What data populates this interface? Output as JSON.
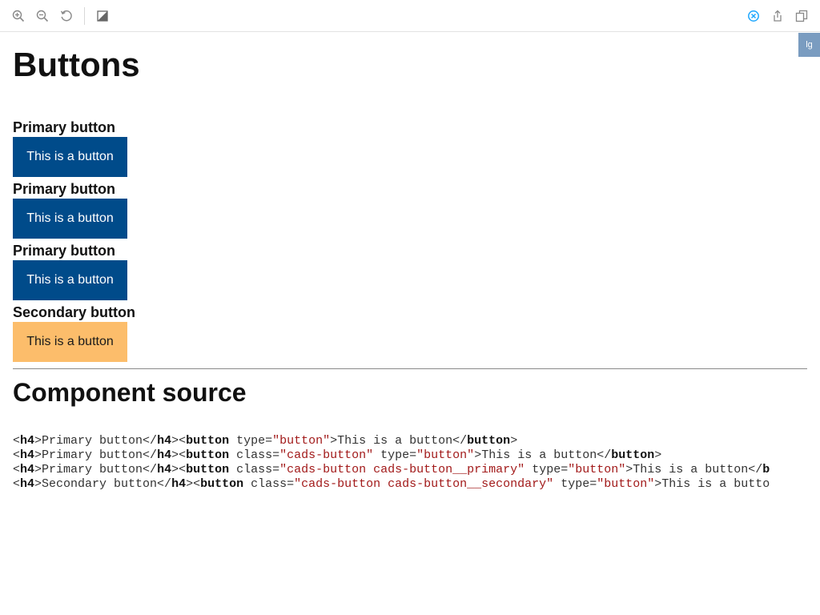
{
  "toolbar": {
    "icons": [
      "zoom-in-icon",
      "zoom-out-icon",
      "reset-zoom-icon",
      "background-icon",
      "close-icon",
      "share-icon",
      "copy-icon"
    ],
    "accent_color": "#1ea7fd"
  },
  "viewport_badge": "lg",
  "page": {
    "title": "Buttons",
    "groups": [
      {
        "heading": "Primary button",
        "button_label": "This is a button",
        "variant": "primary"
      },
      {
        "heading": "Primary button",
        "button_label": "This is a button",
        "variant": "primary"
      },
      {
        "heading": "Primary button",
        "button_label": "This is a button",
        "variant": "primary"
      },
      {
        "heading": "Secondary button",
        "button_label": "This is a button",
        "variant": "secondary"
      }
    ],
    "primary_color": "#004b8a",
    "secondary_color": "#fcbd6b"
  },
  "source": {
    "title": "Component source",
    "lines": [
      [
        {
          "t": "<",
          "c": "p"
        },
        {
          "t": "h4",
          "c": "tag"
        },
        {
          "t": ">Primary button</",
          "c": "p"
        },
        {
          "t": "h4",
          "c": "tag"
        },
        {
          "t": "><",
          "c": "p"
        },
        {
          "t": "button",
          "c": "tag"
        },
        {
          "t": " type=",
          "c": "p"
        },
        {
          "t": "\"button\"",
          "c": "val"
        },
        {
          "t": ">This is a button</",
          "c": "p"
        },
        {
          "t": "button",
          "c": "tag"
        },
        {
          "t": ">",
          "c": "p"
        }
      ],
      [
        {
          "t": "<",
          "c": "p"
        },
        {
          "t": "h4",
          "c": "tag"
        },
        {
          "t": ">Primary button</",
          "c": "p"
        },
        {
          "t": "h4",
          "c": "tag"
        },
        {
          "t": "><",
          "c": "p"
        },
        {
          "t": "button",
          "c": "tag"
        },
        {
          "t": " class=",
          "c": "p"
        },
        {
          "t": "\"cads-button\"",
          "c": "val"
        },
        {
          "t": " type=",
          "c": "p"
        },
        {
          "t": "\"button\"",
          "c": "val"
        },
        {
          "t": ">This is a button</",
          "c": "p"
        },
        {
          "t": "button",
          "c": "tag"
        },
        {
          "t": ">",
          "c": "p"
        }
      ],
      [
        {
          "t": "<",
          "c": "p"
        },
        {
          "t": "h4",
          "c": "tag"
        },
        {
          "t": ">Primary button</",
          "c": "p"
        },
        {
          "t": "h4",
          "c": "tag"
        },
        {
          "t": "><",
          "c": "p"
        },
        {
          "t": "button",
          "c": "tag"
        },
        {
          "t": " class=",
          "c": "p"
        },
        {
          "t": "\"cads-button cads-button__primary\"",
          "c": "val"
        },
        {
          "t": " type=",
          "c": "p"
        },
        {
          "t": "\"button\"",
          "c": "val"
        },
        {
          "t": ">This is a button</",
          "c": "p"
        },
        {
          "t": "b",
          "c": "tag"
        }
      ],
      [
        {
          "t": "<",
          "c": "p"
        },
        {
          "t": "h4",
          "c": "tag"
        },
        {
          "t": ">Secondary button</",
          "c": "p"
        },
        {
          "t": "h4",
          "c": "tag"
        },
        {
          "t": "><",
          "c": "p"
        },
        {
          "t": "button",
          "c": "tag"
        },
        {
          "t": " class=",
          "c": "p"
        },
        {
          "t": "\"cads-button cads-button__secondary\"",
          "c": "val"
        },
        {
          "t": " type=",
          "c": "p"
        },
        {
          "t": "\"button\"",
          "c": "val"
        },
        {
          "t": ">This is a butto",
          "c": "p"
        }
      ]
    ]
  }
}
